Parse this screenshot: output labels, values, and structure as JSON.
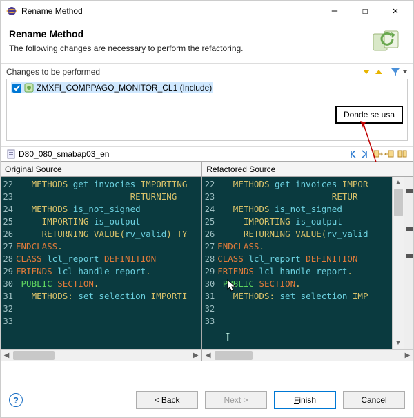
{
  "window": {
    "title": "Rename Method",
    "minimize": "—",
    "maximize": "☐",
    "close": "✕"
  },
  "header": {
    "title": "Rename Method",
    "subtitle": "The following changes are necessary to perform the refactoring."
  },
  "changes": {
    "section_label": "Changes to be performed",
    "item_label": "ZMXFI_COMPPAGO_MONITOR_CL1 (Include)"
  },
  "callout": {
    "label": "Donde se usa"
  },
  "file_bar": {
    "label": "D80_080_smabap03_en"
  },
  "compare": {
    "left_label": "Original Source",
    "right_label": "Refactored Source",
    "line_start": 22,
    "left_lines": [
      {
        "indent": 3,
        "tokens": [
          {
            "t": "METHODS ",
            "c": "kw-yellow"
          },
          {
            "t": "get_invocies ",
            "c": "kw-cyan"
          },
          {
            "t": "IMPORTING",
            "c": "kw-yellow"
          }
        ]
      },
      {
        "indent": 22,
        "tokens": [
          {
            "t": "RETURNING",
            "c": "kw-yellow"
          }
        ]
      },
      {
        "indent": 3,
        "tokens": [
          {
            "t": "METHODS ",
            "c": "kw-yellow"
          },
          {
            "t": "is_not_signed",
            "c": "kw-cyan"
          }
        ]
      },
      {
        "indent": 5,
        "tokens": [
          {
            "t": "IMPORTING ",
            "c": "kw-yellow"
          },
          {
            "t": "is_output",
            "c": "kw-cyan"
          }
        ]
      },
      {
        "indent": 5,
        "tokens": [
          {
            "t": "RETURNING VALUE",
            "c": "kw-yellow"
          },
          {
            "t": "(",
            "c": "kw-yellow"
          },
          {
            "t": "rv_valid",
            "c": "kw-cyan"
          },
          {
            "t": ") TY",
            "c": "kw-yellow"
          }
        ]
      },
      {
        "indent": 0,
        "tokens": [
          {
            "t": "ENDCLASS",
            "c": "kw-orange"
          },
          {
            "t": ".",
            "c": "kw-yellow"
          }
        ]
      },
      {
        "indent": 0,
        "tokens": [
          {
            "t": "CLASS ",
            "c": "kw-orange"
          },
          {
            "t": "lcl_report ",
            "c": "kw-cyan"
          },
          {
            "t": "DEFINITION",
            "c": "kw-orange"
          }
        ]
      },
      {
        "indent": 0,
        "tokens": [
          {
            "t": "FRIENDS ",
            "c": "kw-orange"
          },
          {
            "t": "lcl_handle_report",
            "c": "kw-cyan"
          },
          {
            "t": ".",
            "c": "kw-yellow"
          }
        ]
      },
      {
        "indent": 1,
        "tokens": [
          {
            "t": "PUBLIC ",
            "c": "kw-green"
          },
          {
            "t": "SECTION",
            "c": "kw-orange"
          },
          {
            "t": ".",
            "c": "kw-yellow"
          }
        ]
      },
      {
        "indent": 3,
        "tokens": [
          {
            "t": "METHODS: ",
            "c": "kw-yellow"
          },
          {
            "t": "set_selection ",
            "c": "kw-cyan"
          },
          {
            "t": "IMPORTI",
            "c": "kw-yellow"
          }
        ]
      },
      {
        "indent": 0,
        "tokens": []
      },
      {
        "indent": 0,
        "tokens": []
      }
    ],
    "right_lines": [
      {
        "indent": 3,
        "tokens": [
          {
            "t": "METHODS ",
            "c": "kw-yellow"
          },
          {
            "t": "get_invoices ",
            "c": "kw-cyan"
          },
          {
            "t": "IMPOR",
            "c": "kw-yellow"
          }
        ]
      },
      {
        "indent": 22,
        "tokens": [
          {
            "t": "RETUR",
            "c": "kw-yellow"
          }
        ]
      },
      {
        "indent": 3,
        "tokens": [
          {
            "t": "METHODS ",
            "c": "kw-yellow"
          },
          {
            "t": "is_not_signed",
            "c": "kw-cyan"
          }
        ]
      },
      {
        "indent": 5,
        "tokens": [
          {
            "t": "IMPORTING ",
            "c": "kw-yellow"
          },
          {
            "t": "is_output",
            "c": "kw-cyan"
          }
        ]
      },
      {
        "indent": 5,
        "tokens": [
          {
            "t": "RETURNING VALUE",
            "c": "kw-yellow"
          },
          {
            "t": "(",
            "c": "kw-yellow"
          },
          {
            "t": "rv_valid",
            "c": "kw-cyan"
          }
        ]
      },
      {
        "indent": 0,
        "tokens": [
          {
            "t": "ENDCLASS",
            "c": "kw-orange"
          },
          {
            "t": ".",
            "c": "kw-yellow"
          }
        ]
      },
      {
        "indent": 0,
        "tokens": [
          {
            "t": "CLASS ",
            "c": "kw-orange"
          },
          {
            "t": "lcl_report ",
            "c": "kw-cyan"
          },
          {
            "t": "DEFINITION",
            "c": "kw-orange"
          }
        ]
      },
      {
        "indent": 0,
        "tokens": [
          {
            "t": "FRI",
            "c": "kw-orange"
          },
          {
            "t": "ENDS ",
            "c": "kw-orange"
          },
          {
            "t": "lcl_handle_report",
            "c": "kw-cyan"
          },
          {
            "t": ".",
            "c": "kw-yellow"
          }
        ]
      },
      {
        "indent": 1,
        "tokens": [
          {
            "t": "PUBLIC ",
            "c": "kw-green"
          },
          {
            "t": "SECTION",
            "c": "kw-orange"
          },
          {
            "t": ".",
            "c": "kw-yellow"
          }
        ]
      },
      {
        "indent": 3,
        "tokens": [
          {
            "t": "METHODS: ",
            "c": "kw-yellow"
          },
          {
            "t": "set_selection ",
            "c": "kw-cyan"
          },
          {
            "t": "IMP",
            "c": "kw-yellow"
          }
        ]
      },
      {
        "indent": 0,
        "tokens": []
      },
      {
        "indent": 0,
        "tokens": []
      }
    ]
  },
  "footer": {
    "back": "< Back",
    "next": "Next >",
    "finish": "Finish",
    "cancel": "Cancel"
  }
}
